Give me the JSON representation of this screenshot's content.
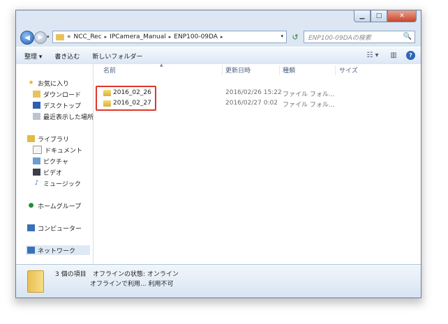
{
  "window": {
    "caption": {
      "minimize": "▁",
      "maximize": "□",
      "close": "✕"
    }
  },
  "navbar": {
    "back_icon": "◀",
    "forward_icon": "▶",
    "address": {
      "prefix": "«",
      "crumbs": [
        "NCC_Rec",
        "IPCamera_Manual",
        "ENP100-09DA"
      ],
      "separator": "▸",
      "dropdown": "▾"
    },
    "refresh_icon": "↺",
    "search_placeholder": "ENP100-09DAの検索",
    "search_icon": "🔍"
  },
  "toolbar": {
    "organize": "整理 ▾",
    "include": "書き込む",
    "new_folder": "新しいフォルダー",
    "view_icon": "☷ ▾",
    "pane_icon": "▥",
    "help_icon": "?"
  },
  "sidebar": {
    "favorites": "お気に入り",
    "downloads": "ダウンロード",
    "desktop": "デスクトップ",
    "recent": "最近表示した場所",
    "libraries": "ライブラリ",
    "documents": "ドキュメント",
    "pictures": "ピクチャ",
    "videos": "ビデオ",
    "music": "ミュージック",
    "homegroup": "ホームグループ",
    "computer": "コンピューター",
    "network": "ネットワーク"
  },
  "columns": {
    "name": "名前",
    "date": "更新日時",
    "type": "種類",
    "size": "サイズ"
  },
  "files": [
    {
      "name": "2016_02_26",
      "date": "2016/02/26 15:22",
      "type": "ファイル フォル..."
    },
    {
      "name": "2016_02_27",
      "date": "2016/02/27 0:02",
      "type": "ファイル フォル..."
    }
  ],
  "status": {
    "count": "3 個の項目",
    "offline_status": "オフラインの状態: オンライン",
    "offline_avail": "オフラインで利用... 利用不可"
  },
  "colors": {
    "highlight": "#e0352b",
    "folder": "#e8c35c"
  }
}
